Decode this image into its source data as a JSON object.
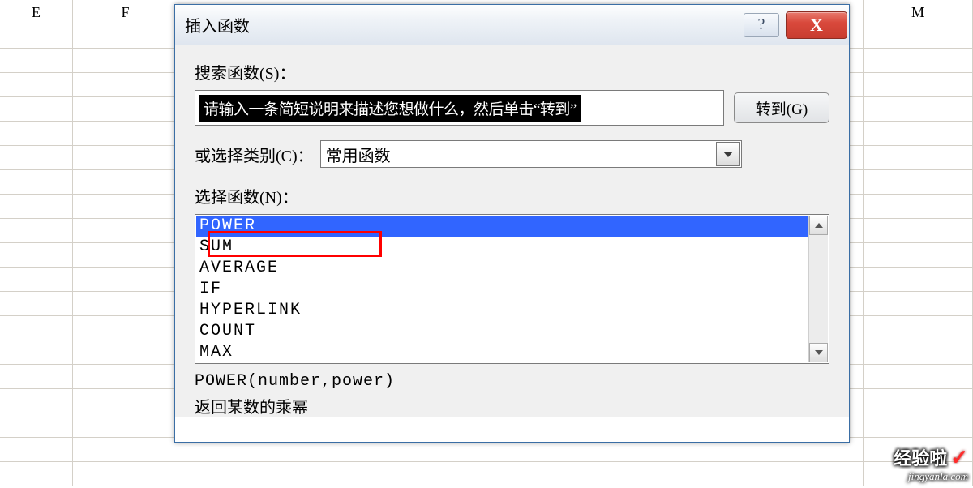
{
  "spreadsheet": {
    "columns": [
      "E",
      "F",
      "M"
    ]
  },
  "dialog": {
    "title": "插入函数",
    "help_glyph": "?",
    "close_glyph": "X",
    "search_label": "搜索函数(S)：",
    "search_placeholder": "请输入一条简短说明来描述您想做什么，然后单击“转到”",
    "go_label": "转到(G)",
    "category_label": "或选择类别(C)：",
    "category_value": "常用函数",
    "select_label": "选择函数(N)：",
    "functions": [
      "POWER",
      "SUM",
      "AVERAGE",
      "IF",
      "HYPERLINK",
      "COUNT",
      "MAX"
    ],
    "selected_function": "POWER",
    "signature": "POWER(number,power)",
    "description": "返回某数的乘幂"
  },
  "watermark": {
    "line1": "经验啦",
    "check": "✓",
    "line2": "jingyanla.com"
  }
}
